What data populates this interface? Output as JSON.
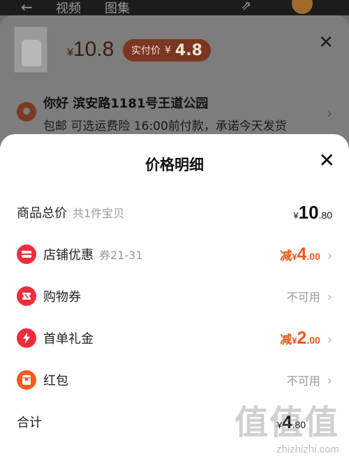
{
  "topbar": {
    "back": "←",
    "left_text": "视频",
    "left_text2": "图集",
    "icon": "⇗"
  },
  "product_summary": {
    "currency": "¥",
    "price": "10.8",
    "real_price_label": "实付价",
    "real_price_currency": "¥",
    "real_price": "4.8",
    "close": "✕"
  },
  "address": {
    "name": "你好 滨安路1181号王道公园",
    "shipping": "包邮 可选运费险 16:00前付款，承诺今天发货",
    "chevron": "›"
  },
  "price_detail": {
    "title": "价格明细",
    "close": "✕",
    "total_goods": {
      "label": "商品总价",
      "hint": "共1件宝贝",
      "currency": "¥",
      "int": "10",
      "dec": ".80"
    },
    "rows": [
      {
        "label": "店铺优惠",
        "hint": "券21-31",
        "icon": "shop-coupon-icon",
        "color": "#ee2d3c",
        "prefix": "减",
        "currency": "¥",
        "int": "4",
        "dec": ".00",
        "available": true
      },
      {
        "label": "购物券",
        "hint": "",
        "icon": "ticket-icon",
        "color": "#ee2d3c",
        "status": "不可用",
        "available": false
      },
      {
        "label": "首单礼金",
        "hint": "",
        "icon": "lightning-icon",
        "color": "#ee2d3c",
        "prefix": "减",
        "currency": "¥",
        "int": "2",
        "dec": ".00",
        "available": true
      },
      {
        "label": "红包",
        "hint": "",
        "icon": "red-packet-icon",
        "color": "#f25a1f",
        "status": "不可用",
        "available": false
      }
    ],
    "total": {
      "label": "合计",
      "currency": "¥",
      "int": "4",
      "dec": ".80"
    },
    "chevron": "›"
  },
  "watermark": {
    "big": "值值值",
    "small": "zhizhizhi.com"
  }
}
